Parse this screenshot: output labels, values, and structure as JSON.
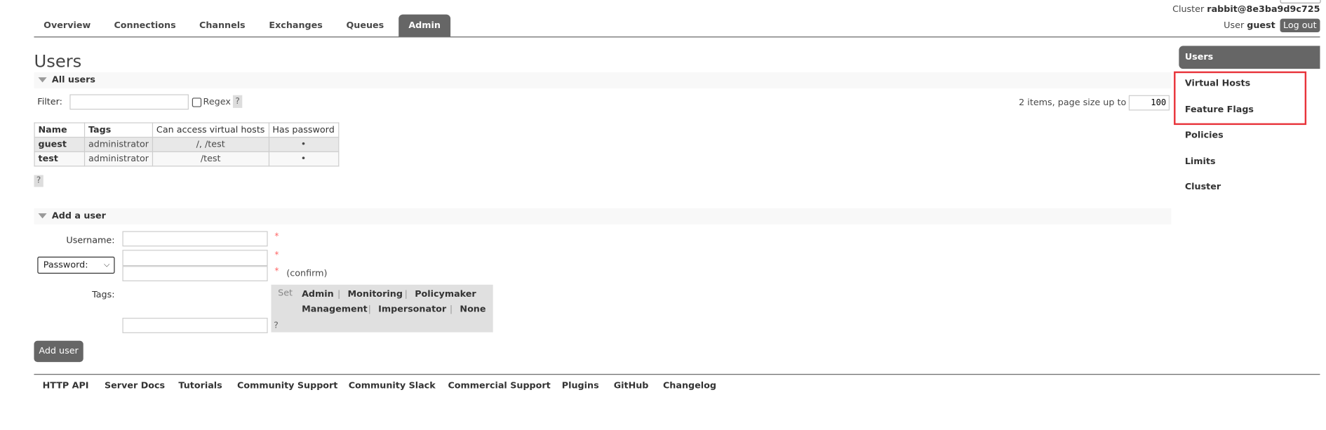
{
  "nav": {
    "tabs": [
      {
        "label": "Overview"
      },
      {
        "label": "Connections"
      },
      {
        "label": "Channels"
      },
      {
        "label": "Exchanges"
      },
      {
        "label": "Queues"
      },
      {
        "label": "Admin",
        "active": true
      }
    ]
  },
  "header": {
    "cluster_label": "Cluster",
    "cluster_name": "rabbit@8e3ba9d9c725",
    "user_label": "User",
    "user_name": "guest",
    "logout_label": "Log out"
  },
  "page_title": "Users",
  "all_users": {
    "title": "All users",
    "filter_label": "Filter:",
    "filter_value": "",
    "regex_label": "Regex",
    "help": "?",
    "items_text": "2 items, page size up to",
    "page_size": "100",
    "columns": [
      "Name",
      "Tags",
      "Can access virtual hosts",
      "Has password"
    ],
    "rows": [
      {
        "name": "guest",
        "tags": "administrator",
        "vhosts": "/, /test",
        "has_password": "•"
      },
      {
        "name": "test",
        "tags": "administrator",
        "vhosts": "/test",
        "has_password": "•"
      }
    ]
  },
  "add_user": {
    "title": "Add a user",
    "username_label": "Username:",
    "password_select": "Password:",
    "required": "*",
    "confirm": "(confirm)",
    "tags_label": "Tags:",
    "set_label": "Set",
    "tags": [
      "Admin",
      "Monitoring",
      "Policymaker",
      "Management",
      "Impersonator",
      "None"
    ],
    "sep": "|",
    "help": "?",
    "submit": "Add user"
  },
  "sidebar": {
    "items": [
      {
        "label": "Users",
        "active": true
      },
      {
        "label": "Virtual Hosts"
      },
      {
        "label": "Feature Flags"
      },
      {
        "label": "Policies"
      },
      {
        "label": "Limits"
      },
      {
        "label": "Cluster"
      }
    ],
    "highlight_color": "#e8333a"
  },
  "footer": {
    "links": [
      "HTTP API",
      "Server Docs",
      "Tutorials",
      "Community Support",
      "Community Slack",
      "Commercial Support",
      "Plugins",
      "GitHub",
      "Changelog"
    ]
  }
}
